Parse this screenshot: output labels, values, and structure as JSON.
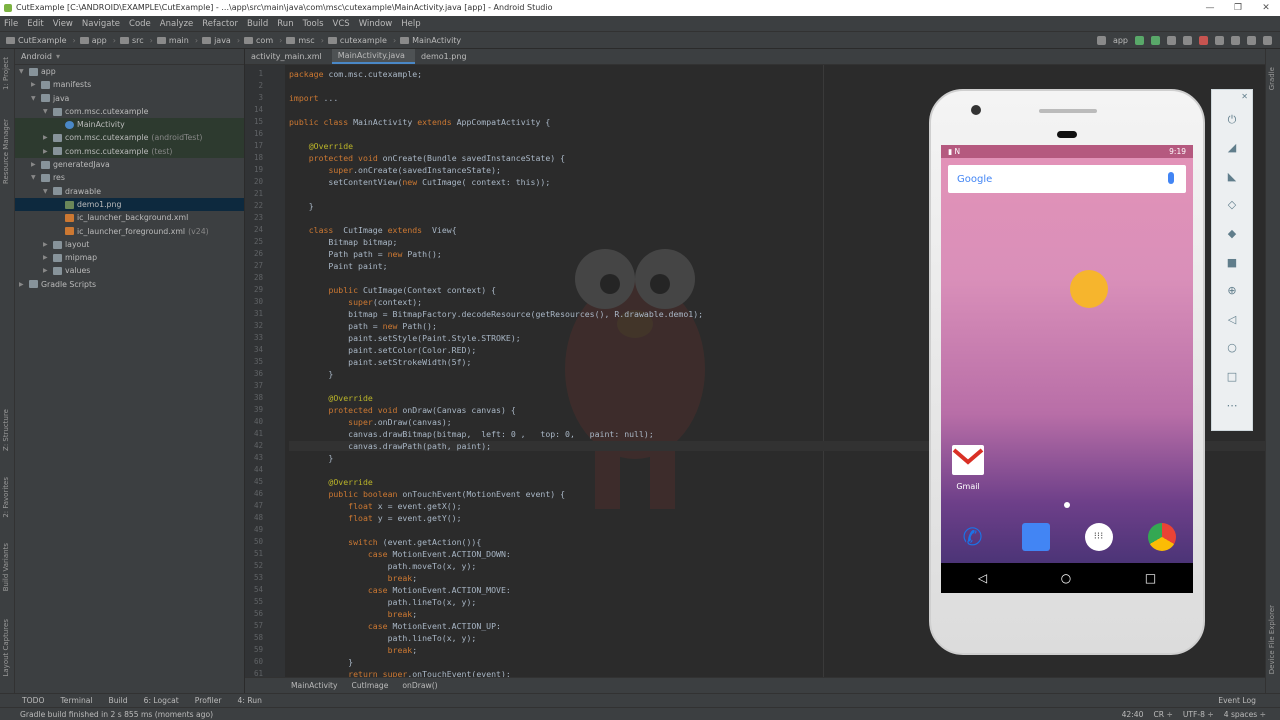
{
  "window": {
    "title": "CutExample [C:\\ANDROID\\EXAMPLE\\CutExample] - ...\\app\\src\\main\\java\\com\\msc\\cutexample\\MainActivity.java [app] - Android Studio"
  },
  "menu": [
    "File",
    "Edit",
    "View",
    "Navigate",
    "Code",
    "Analyze",
    "Refactor",
    "Build",
    "Run",
    "Tools",
    "VCS",
    "Window",
    "Help"
  ],
  "breadcrumbs": [
    "CutExample",
    "app",
    "src",
    "main",
    "java",
    "com",
    "msc",
    "cutexample",
    "MainActivity"
  ],
  "run_config": "app",
  "project_panel": {
    "header": "Android",
    "items": [
      {
        "label": "app",
        "indent": 0,
        "arrow": "▼",
        "sfx": ""
      },
      {
        "label": "manifests",
        "indent": 1,
        "arrow": "▶",
        "sfx": ""
      },
      {
        "label": "java",
        "indent": 1,
        "arrow": "▼",
        "sfx": ""
      },
      {
        "label": "com.msc.cutexample",
        "indent": 2,
        "arrow": "▼",
        "sfx": ""
      },
      {
        "label": "MainActivity",
        "indent": 3,
        "arrow": "",
        "sfx": ""
      },
      {
        "label": "com.msc.cutexample",
        "indent": 2,
        "arrow": "▶",
        "sfx": "(androidTest)"
      },
      {
        "label": "com.msc.cutexample",
        "indent": 2,
        "arrow": "▶",
        "sfx": "(test)"
      },
      {
        "label": "generatedJava",
        "indent": 1,
        "arrow": "▶",
        "sfx": ""
      },
      {
        "label": "res",
        "indent": 1,
        "arrow": "▼",
        "sfx": ""
      },
      {
        "label": "drawable",
        "indent": 2,
        "arrow": "▼",
        "sfx": ""
      },
      {
        "label": "demo1.png",
        "indent": 3,
        "arrow": "",
        "sfx": ""
      },
      {
        "label": "ic_launcher_background.xml",
        "indent": 3,
        "arrow": "",
        "sfx": ""
      },
      {
        "label": "ic_launcher_foreground.xml",
        "indent": 3,
        "arrow": "",
        "sfx": "(v24)"
      },
      {
        "label": "layout",
        "indent": 2,
        "arrow": "▶",
        "sfx": ""
      },
      {
        "label": "mipmap",
        "indent": 2,
        "arrow": "▶",
        "sfx": ""
      },
      {
        "label": "values",
        "indent": 2,
        "arrow": "▶",
        "sfx": ""
      },
      {
        "label": "Gradle Scripts",
        "indent": 0,
        "arrow": "▶",
        "sfx": ""
      }
    ]
  },
  "editor_tabs": [
    "activity_main.xml",
    "MainActivity.java",
    "demo1.png"
  ],
  "code_lines": [
    {
      "n": "1",
      "t": "package com.msc.cutexample;"
    },
    {
      "n": "2",
      "t": ""
    },
    {
      "n": "3",
      "t": "import ..."
    },
    {
      "n": "14",
      "t": ""
    },
    {
      "n": "15",
      "t": "public class MainActivity extends AppCompatActivity {"
    },
    {
      "n": "16",
      "t": ""
    },
    {
      "n": "17",
      "t": "    @Override"
    },
    {
      "n": "18",
      "t": "    protected void onCreate(Bundle savedInstanceState) {"
    },
    {
      "n": "19",
      "t": "        super.onCreate(savedInstanceState);"
    },
    {
      "n": "20",
      "t": "        setContentView(new CutImage( context: this));"
    },
    {
      "n": "21",
      "t": ""
    },
    {
      "n": "22",
      "t": "    }"
    },
    {
      "n": "23",
      "t": ""
    },
    {
      "n": "24",
      "t": "    class  CutImage extends  View{"
    },
    {
      "n": "25",
      "t": "        Bitmap bitmap;"
    },
    {
      "n": "26",
      "t": "        Path path = new Path();"
    },
    {
      "n": "27",
      "t": "        Paint paint;"
    },
    {
      "n": "28",
      "t": ""
    },
    {
      "n": "29",
      "t": "        public CutImage(Context context) {"
    },
    {
      "n": "30",
      "t": "            super(context);"
    },
    {
      "n": "31",
      "t": "            bitmap = BitmapFactory.decodeResource(getResources(), R.drawable.demo1);"
    },
    {
      "n": "32",
      "t": "            path = new Path();"
    },
    {
      "n": "33",
      "t": "            paint.setStyle(Paint.Style.STROKE);"
    },
    {
      "n": "34",
      "t": "            paint.setColor(Color.RED);"
    },
    {
      "n": "35",
      "t": "            paint.setStrokeWidth(5f);"
    },
    {
      "n": "36",
      "t": "        }"
    },
    {
      "n": "37",
      "t": ""
    },
    {
      "n": "38",
      "t": "        @Override"
    },
    {
      "n": "39",
      "t": "        protected void onDraw(Canvas canvas) {"
    },
    {
      "n": "40",
      "t": "            super.onDraw(canvas);"
    },
    {
      "n": "41",
      "t": "            canvas.drawBitmap(bitmap,  left: 0 ,   top: 0,   paint: null);"
    },
    {
      "n": "42",
      "t": "            canvas.drawPath(path, paint);"
    },
    {
      "n": "43",
      "t": "        }"
    },
    {
      "n": "44",
      "t": ""
    },
    {
      "n": "45",
      "t": "        @Override"
    },
    {
      "n": "46",
      "t": "        public boolean onTouchEvent(MotionEvent event) {"
    },
    {
      "n": "47",
      "t": "            float x = event.getX();"
    },
    {
      "n": "48",
      "t": "            float y = event.getY();"
    },
    {
      "n": "49",
      "t": ""
    },
    {
      "n": "50",
      "t": "            switch (event.getAction()){"
    },
    {
      "n": "51",
      "t": "                case MotionEvent.ACTION_DOWN:"
    },
    {
      "n": "52",
      "t": "                    path.moveTo(x, y);"
    },
    {
      "n": "53",
      "t": "                    break;"
    },
    {
      "n": "54",
      "t": "                case MotionEvent.ACTION_MOVE:"
    },
    {
      "n": "55",
      "t": "                    path.lineTo(x, y);"
    },
    {
      "n": "56",
      "t": "                    break;"
    },
    {
      "n": "57",
      "t": "                case MotionEvent.ACTION_UP:"
    },
    {
      "n": "58",
      "t": "                    path.lineTo(x, y);"
    },
    {
      "n": "59",
      "t": "                    break;"
    },
    {
      "n": "60",
      "t": "            }"
    },
    {
      "n": "61",
      "t": "            return super.onTouchEvent(event);"
    }
  ],
  "editor_breadcrumb": [
    "MainActivity",
    "CutImage",
    "onDraw()"
  ],
  "left_tool_tabs": [
    "1: Project",
    "Resource Manager",
    "Z: Structure",
    "2: Favorites",
    "Build Variants",
    "Layout Captures"
  ],
  "right_tool_tabs": [
    "Gradle",
    "Device File Explorer"
  ],
  "tool_windows": [
    "TODO",
    "Terminal",
    "Build",
    "6: Logcat",
    "Profiler",
    "4: Run"
  ],
  "event_log": "Event Log",
  "status": {
    "message": "Gradle build finished in 2 s 855 ms (moments ago)",
    "position": "42:40",
    "line_sep": "CR ÷",
    "encoding": "UTF-8 ÷",
    "indent": "4 spaces ÷"
  },
  "phone": {
    "time": "9:19",
    "search_brand": "Google",
    "gmail_label": "Gmail"
  },
  "colors": {
    "touch_indicator": "#f6b52d",
    "accent": "#4a88c7"
  }
}
